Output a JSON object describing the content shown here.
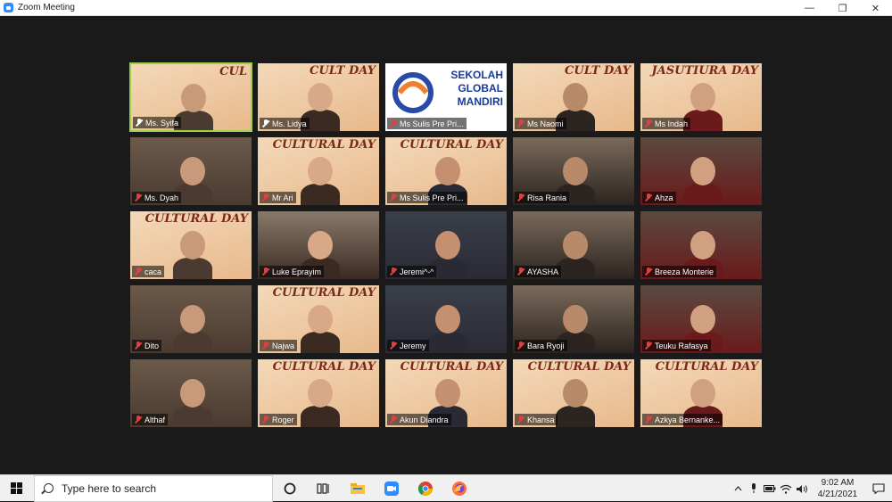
{
  "window": {
    "title": "Zoom Meeting",
    "minimize": "—",
    "maximize": "❐",
    "close": "✕"
  },
  "participants": [
    {
      "name": "Ms. Syifa",
      "muted": false,
      "pinned": true,
      "active": true,
      "poster": true,
      "poster_text": "CUL"
    },
    {
      "name": "Ms. Lidya",
      "muted": false,
      "pinned": true,
      "poster": true,
      "poster_text": "CULT DAY"
    },
    {
      "name": "Ms Sulis Pre Pri...",
      "muted": true,
      "logo_text": "SEKOLAH GLOBAL MANDIRI"
    },
    {
      "name": "Ms Naomi",
      "muted": true,
      "poster": true,
      "poster_text": "CULT DAY"
    },
    {
      "name": "Ms Indah",
      "muted": true,
      "poster": true,
      "poster_text": "JASUTIURA DAY"
    },
    {
      "name": "Ms. Dyah",
      "muted": true
    },
    {
      "name": "Mr Ari",
      "muted": true,
      "poster": true,
      "poster_text": "CULTURAL DAY"
    },
    {
      "name": "Ms Sulis Pre Pri...",
      "muted": true,
      "poster": true,
      "poster_text": "CULTURAL DAY"
    },
    {
      "name": "Risa Rania",
      "muted": true
    },
    {
      "name": "Ahza",
      "muted": true
    },
    {
      "name": "caca",
      "muted": true,
      "poster": true,
      "poster_text": "CULTURAL DAY"
    },
    {
      "name": "Luke Eprayim",
      "muted": true
    },
    {
      "name": "Jeremi^-^",
      "muted": true
    },
    {
      "name": "AYASHA",
      "muted": true
    },
    {
      "name": "Breeza Monterie",
      "muted": true
    },
    {
      "name": "Dito",
      "muted": true
    },
    {
      "name": "Najwa",
      "muted": true,
      "poster": true,
      "poster_text": "CULTURAL DAY"
    },
    {
      "name": "Jeremy",
      "muted": true
    },
    {
      "name": "Bara Ryoji",
      "muted": true
    },
    {
      "name": "Teuku Rafasya",
      "muted": true
    },
    {
      "name": "Althaf",
      "muted": true
    },
    {
      "name": "Roger",
      "muted": true,
      "poster": true,
      "poster_text": "CULTURAL DAY"
    },
    {
      "name": "Akun Diandra",
      "muted": true,
      "poster": true,
      "poster_text": "CULTURAL DAY"
    },
    {
      "name": "Khansa",
      "muted": true,
      "poster": true,
      "poster_text": "CULTURAL DAY"
    },
    {
      "name": "Azkya Bernanke...",
      "muted": true,
      "poster": true,
      "poster_text": "CULTURAL DAY"
    }
  ],
  "taskbar": {
    "search_placeholder": "Type here to search",
    "time": "9:02 AM",
    "date": "4/21/2021",
    "apps": [
      "task-view-icon",
      "file-explorer-icon",
      "zoom-icon",
      "chrome-icon",
      "firefox-icon"
    ]
  },
  "colors": {
    "active_border": "#9bd14b",
    "muted_mic": "#e04040",
    "zoom_blue": "#2d8cff"
  }
}
